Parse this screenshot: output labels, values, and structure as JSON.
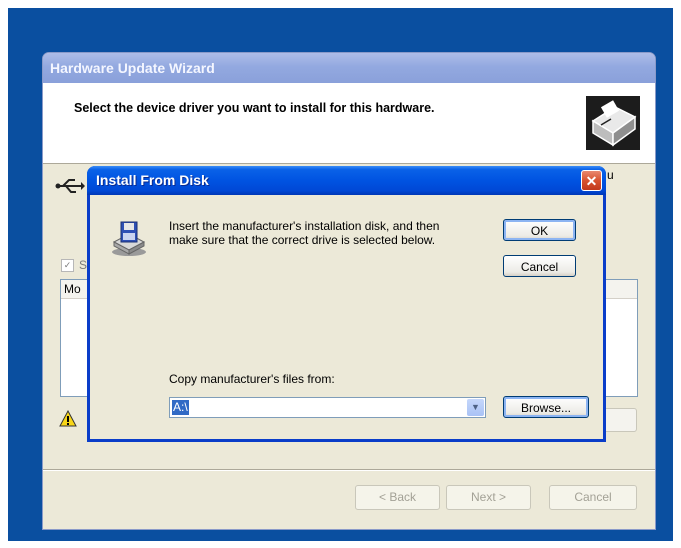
{
  "wizard": {
    "title": "Hardware Update Wizard",
    "header_text": "Select the device driver you want to install for this hardware.",
    "checkbox_label": "S",
    "list_header": "Mo",
    "partial_text": "u",
    "buttons": {
      "back": "< Back",
      "next": "Next >",
      "cancel": "Cancel"
    }
  },
  "dialog": {
    "title": "Install From Disk",
    "close": "✕",
    "message": "Insert the manufacturer's installation disk, and then make sure that the correct drive is selected below.",
    "ok_label": "OK",
    "cancel_label": "Cancel",
    "copy_label": "Copy manufacturer's files from:",
    "path_value": "A:\\",
    "browse_label": "Browse..."
  },
  "icons": [
    "usb-icon",
    "hardware-wizard-icon",
    "warning-icon",
    "floppy-disk-icon",
    "close-icon",
    "chevron-down-icon"
  ],
  "colors": {
    "desktop": "#0a4fa0",
    "titlebar_active": "#0053e1",
    "window_face": "#ece9d8",
    "selection": "#316ac5"
  }
}
